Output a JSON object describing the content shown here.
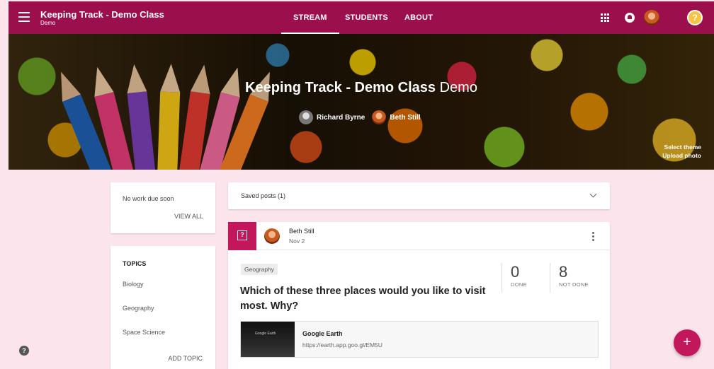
{
  "header": {
    "class_name": "Keeping Track - Demo Class",
    "section": "Demo",
    "tabs": [
      {
        "label": "STREAM",
        "active": true
      },
      {
        "label": "STUDENTS",
        "active": false
      },
      {
        "label": "ABOUT",
        "active": false
      }
    ],
    "icons": [
      "menu-icon",
      "apps-icon",
      "notifications-icon",
      "avatar",
      "help-icon"
    ]
  },
  "banner": {
    "title": "Keeping Track - Demo Class",
    "section": "Demo",
    "teachers": [
      "Richard Byrne",
      "Beth Still"
    ],
    "select_theme": "Select theme",
    "upload_photo": "Upload photo"
  },
  "upcoming": {
    "message": "No work due soon",
    "view_all": "VIEW ALL"
  },
  "topics": {
    "heading": "TOPICS",
    "items": [
      "Biology",
      "Geography",
      "Space Science"
    ],
    "add_label": "ADD TOPIC"
  },
  "saved_posts": {
    "label": "Saved posts (1)"
  },
  "post": {
    "author": "Beth Still",
    "date": "Nov 2",
    "topic": "Geography",
    "question": "Which of these three places would you like to visit most. Why?",
    "done_count": "0",
    "done_label": "DONE",
    "not_done_count": "8",
    "not_done_label": "NOT DONE",
    "attachment": {
      "thumb_text": "Google Earth",
      "title": "Google Earth",
      "url": "https://earth.app.goo.gl/EM5U"
    }
  },
  "fab_label": "+",
  "help_glyph": "?",
  "colors": {
    "primary": "#9c0f4d",
    "accent": "#c2185b",
    "page_background": "#fce4ec"
  }
}
